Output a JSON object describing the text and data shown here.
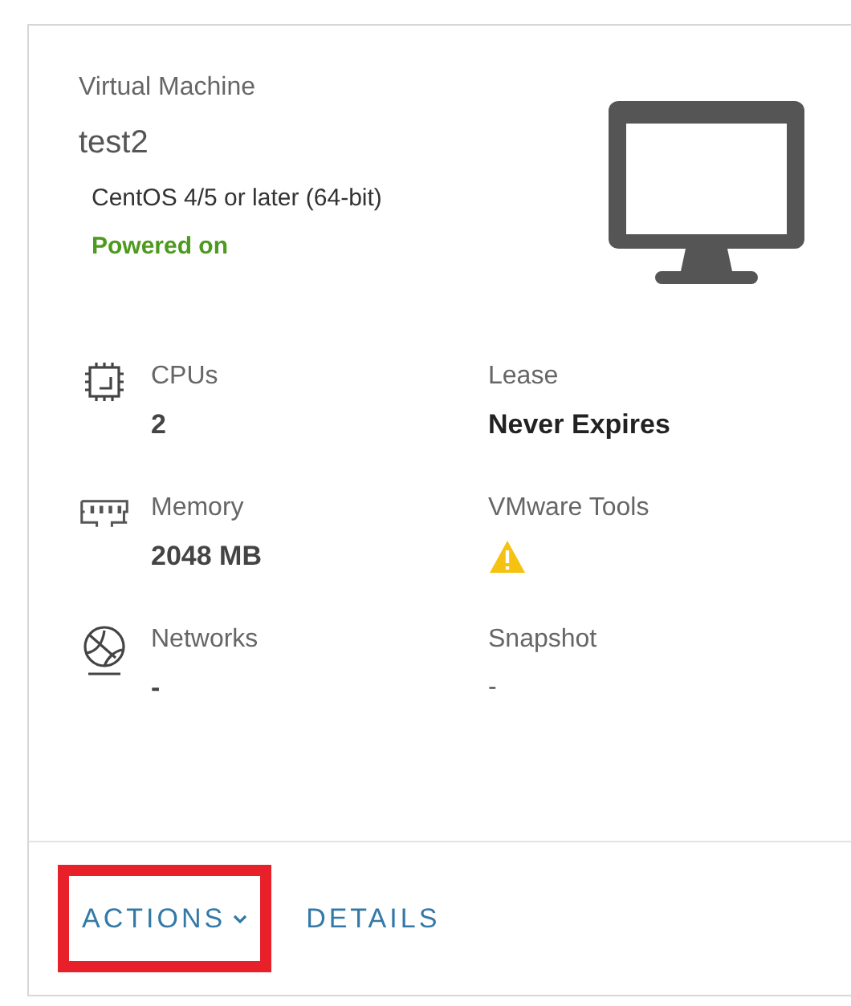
{
  "card": {
    "type_label": "Virtual Machine",
    "name": "test2",
    "guest_os": "CentOS 4/5 or later (64-bit)",
    "power_state": "Powered on",
    "powered_on": true,
    "left_properties": [
      {
        "kind": "cpu",
        "label": "CPUs",
        "value": "2"
      },
      {
        "kind": "memory",
        "label": "Memory",
        "value": "2048 MB"
      },
      {
        "kind": "network",
        "label": "Networks",
        "value": "-"
      }
    ],
    "right_properties": [
      {
        "kind": "text",
        "label": "Lease",
        "value": "Never Expires",
        "bold": true
      },
      {
        "kind": "warning",
        "label": "VMware Tools"
      },
      {
        "kind": "text",
        "label": "Snapshot",
        "value": "-",
        "bold": false
      }
    ],
    "actions": [
      {
        "label": "ACTIONS",
        "dropdown": true,
        "highlighted": true
      },
      {
        "label": "DETAILS",
        "dropdown": false,
        "highlighted": false
      }
    ]
  }
}
